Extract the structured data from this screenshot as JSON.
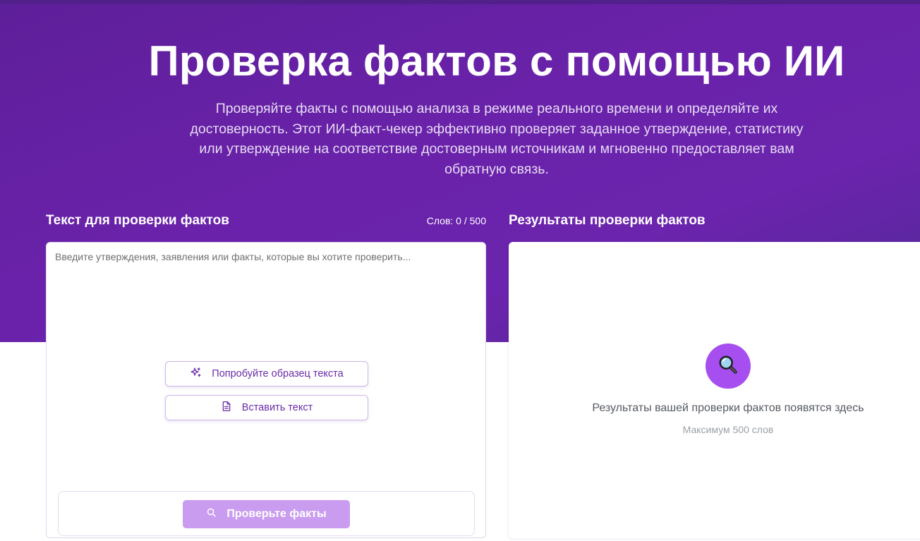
{
  "hero": {
    "title": "Проверка фактов с помощью ИИ",
    "description": "Проверяйте факты с помощью анализа в режиме реального времени и определяйте их достоверность. Этот ИИ-факт-чекер эффективно проверяет заданное утверждение, статистику или утверждение на соответствие достоверным источникам и мгновенно предоставляет вам обратную связь."
  },
  "input_panel": {
    "label": "Текст для проверки фактов",
    "word_count": "Слов: 0 / 500",
    "textarea_value": "",
    "textarea_placeholder": "Введите утверждения, заявления или факты, которые вы хотите проверить...",
    "sample_button": {
      "label": "Попробуйте образец текста",
      "icon": "sparkles-icon"
    },
    "paste_button": {
      "label": "Вставить текст",
      "icon": "document-icon"
    },
    "check_button": {
      "label": "Проверьте факты",
      "icon": "search-icon"
    }
  },
  "result_panel": {
    "label": "Результаты проверки фактов",
    "icon": "magnifier-icon",
    "empty_text": "Результаты вашей проверки фактов появятся здесь",
    "sub_text": "Максимум 500 слов"
  },
  "colors": {
    "hero_purple": "#6a22aa",
    "accent_purple": "#a64ef0",
    "button_disabled": "#c99cef",
    "button_text": "#6a2aa8"
  }
}
